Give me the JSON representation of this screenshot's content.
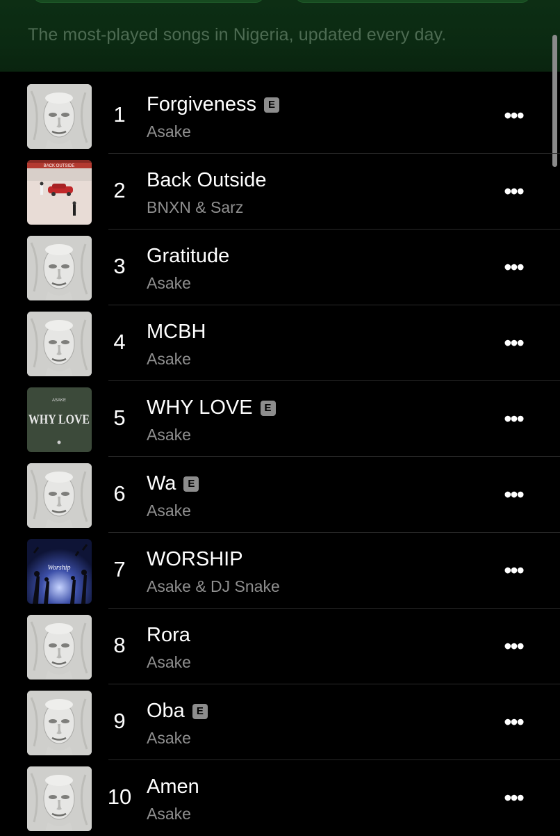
{
  "header": {
    "subtitle": "The most-played songs in Nigeria, updated every day."
  },
  "songs": [
    {
      "rank": "1",
      "title": "Forgiveness",
      "explicit": true,
      "artist": "Asake",
      "art": "face"
    },
    {
      "rank": "2",
      "title": "Back Outside",
      "explicit": false,
      "artist": "BNXN & Sarz",
      "art": "back-outside"
    },
    {
      "rank": "3",
      "title": "Gratitude",
      "explicit": false,
      "artist": "Asake",
      "art": "face"
    },
    {
      "rank": "4",
      "title": "MCBH",
      "explicit": false,
      "artist": "Asake",
      "art": "face"
    },
    {
      "rank": "5",
      "title": "WHY LOVE",
      "explicit": true,
      "artist": "Asake",
      "art": "why-love"
    },
    {
      "rank": "6",
      "title": "Wa",
      "explicit": true,
      "artist": "Asake",
      "art": "face"
    },
    {
      "rank": "7",
      "title": "WORSHIP",
      "explicit": false,
      "artist": "Asake & DJ Snake",
      "art": "worship"
    },
    {
      "rank": "8",
      "title": "Rora",
      "explicit": false,
      "artist": "Asake",
      "art": "face"
    },
    {
      "rank": "9",
      "title": "Oba",
      "explicit": true,
      "artist": "Asake",
      "art": "face"
    },
    {
      "rank": "10",
      "title": "Amen",
      "explicit": false,
      "artist": "Asake",
      "art": "face"
    }
  ],
  "labels": {
    "explicit_badge": "E",
    "more_glyph": "•••",
    "why_love_art_text": "WHY LOVE",
    "why_love_art_artist": "ASAKE",
    "back_outside_art_text": "BACK OUTSIDE",
    "worship_art_text": "Worship"
  },
  "icons": {
    "explicit": "explicit-badge-icon",
    "more": "more-options-icon"
  },
  "colors": {
    "background": "#000000",
    "header_green": "#0b2a12",
    "subtitle_text": "#4d6b52",
    "primary_text": "#ffffff",
    "secondary_text": "#8f8f8f",
    "explicit_badge": "#8d8d8d",
    "separator": "#2a2a2a"
  }
}
